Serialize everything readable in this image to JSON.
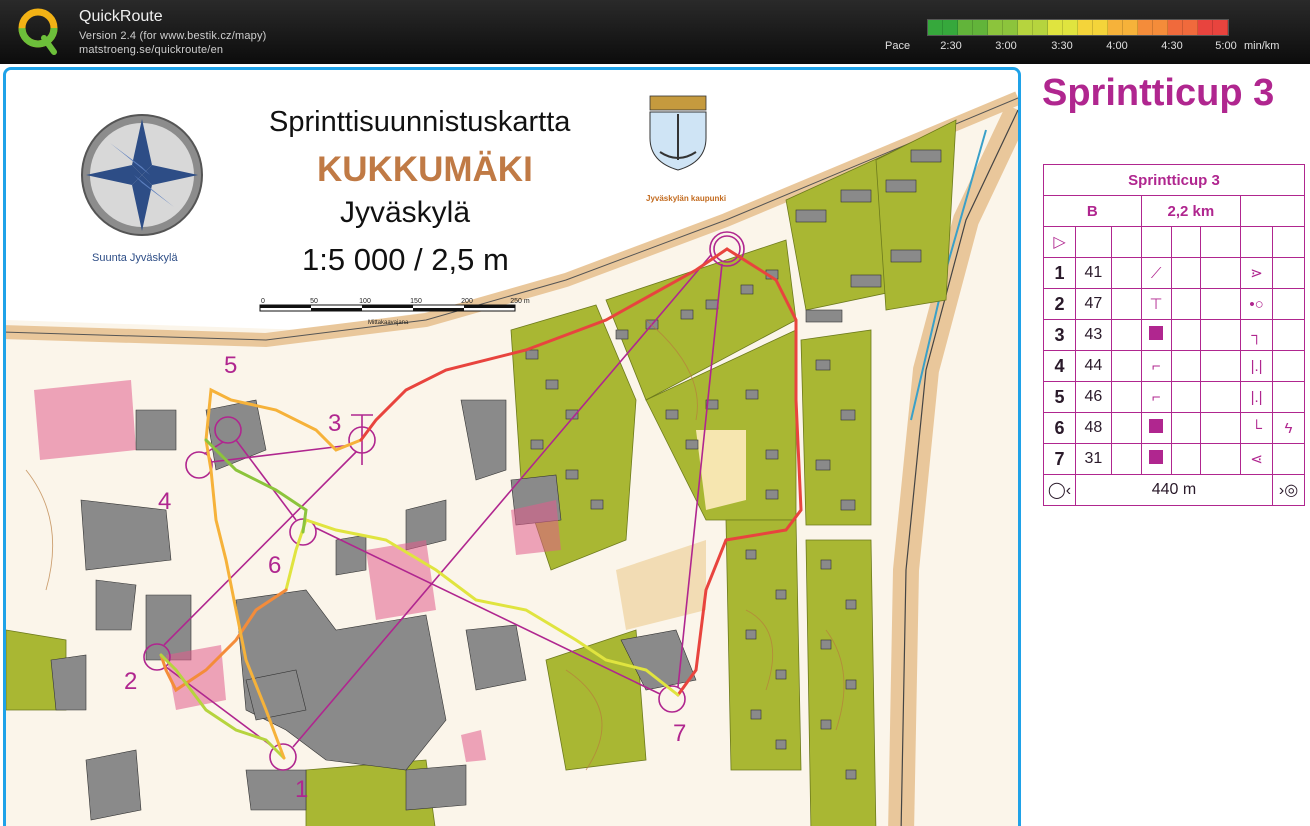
{
  "app": {
    "title": "QuickRoute",
    "version": "Version 2.4  (for www.bestik.cz/mapy)",
    "url": "matstroeng.se/quickroute/en"
  },
  "pace_legend": {
    "label": "Pace",
    "ticks": [
      "2:30",
      "3:00",
      "3:30",
      "4:00",
      "4:30",
      "5:00"
    ],
    "unit": "min/km",
    "gradient_colors": [
      "#36a83c",
      "#62b43a",
      "#8cc43c",
      "#b6d43e",
      "#e0e43f",
      "#f4d43a",
      "#f6b23a",
      "#f48c3a",
      "#f06a3c",
      "#e8443e"
    ]
  },
  "map": {
    "title": "Sprinttisuunnistuskartta",
    "name": "KUKKUMÄKI",
    "city": "Jyväskylä",
    "scale": "1:5 000 / 2,5 m",
    "club": "Suunta Jyväskylä",
    "town_logo_text": "Jyväskylän kaupunki",
    "scale_bar_labels": [
      "0",
      "50",
      "100",
      "150",
      "200",
      "250 m"
    ],
    "scale_bar_caption": "Mittakaavajana",
    "control_labels": [
      "1",
      "2",
      "3",
      "4",
      "5",
      "6",
      "7"
    ],
    "colors": {
      "paper": "#fbf5ea",
      "vegetation": "#a9b733",
      "building": "#8a8a8a",
      "road": "#e9c79b",
      "purple": "#b0268f",
      "frame": "#1fa2e8"
    }
  },
  "course": {
    "heading": "Sprintticup 3",
    "table_title": "Sprintticup 3",
    "class": "B",
    "length": "2,2 km",
    "controls": [
      {
        "num": "1",
        "code": "41",
        "sym": "slope-icon",
        "sym2": "side-icon"
      },
      {
        "num": "2",
        "code": "47",
        "sym": "t-junction-icon",
        "sym2": "circle-side-icon"
      },
      {
        "num": "3",
        "code": "43",
        "sym": "square-icon",
        "sym2": "corner-icon"
      },
      {
        "num": "4",
        "code": "44",
        "sym": "steps-icon",
        "sym2": "between-icon"
      },
      {
        "num": "5",
        "code": "46",
        "sym": "steps-icon",
        "sym2": "between-icon"
      },
      {
        "num": "6",
        "code": "48",
        "sym": "square-icon",
        "sym2": "corner-icon"
      },
      {
        "num": "7",
        "code": "31",
        "sym": "square-icon",
        "sym2": "angle-icon"
      }
    ],
    "finish_distance": "440 m"
  }
}
